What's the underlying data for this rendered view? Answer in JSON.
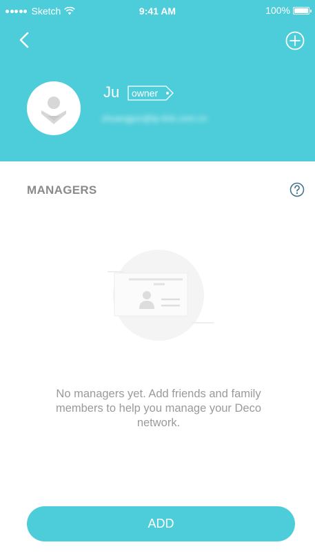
{
  "status_bar": {
    "carrier": "Sketch",
    "time": "9:41 AM",
    "battery": "100%"
  },
  "header": {
    "user_name": "Ju",
    "role_tag": "owner",
    "email": "zhuangjun@tp-link.com.cn"
  },
  "managers": {
    "section_title": "MANAGERS",
    "empty_message": "No managers yet. Add friends and family members to help you manage your Deco network.",
    "add_label": "ADD"
  },
  "colors": {
    "accent": "#4dcdd9",
    "section_text": "#8a8a8a",
    "body_text": "#9a9a9a"
  },
  "icons": {
    "back": "chevron-left-icon",
    "add": "plus-circle-icon",
    "help": "question-circle-icon",
    "avatar": "user-placeholder-icon",
    "empty": "id-card-illustration"
  }
}
